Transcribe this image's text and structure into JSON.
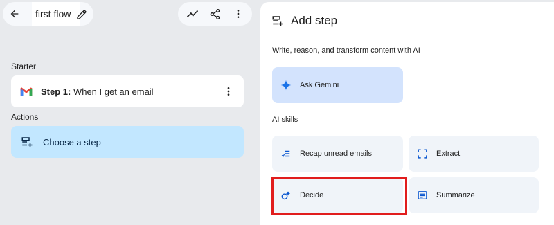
{
  "header": {
    "flow_name": "first flow"
  },
  "left": {
    "starter_label": "Starter",
    "starter_step": {
      "step_prefix": "Step 1:",
      "text": " When I get an email"
    },
    "actions_label": "Actions",
    "choose_label": "Choose a step"
  },
  "panel": {
    "title": "Add step",
    "write_section": "Write, reason, and transform content with AI",
    "ask_gemini": "Ask Gemini",
    "ai_skills_label": "AI skills",
    "skills": [
      {
        "label": "Recap unread emails",
        "icon": "recap-icon"
      },
      {
        "label": "Extract",
        "icon": "extract-icon"
      },
      {
        "label": "Decide",
        "icon": "decide-icon"
      },
      {
        "label": "Summarize",
        "icon": "summarize-icon"
      }
    ]
  },
  "colors": {
    "accent": "#0b57d0",
    "choose_bg": "#c2e7ff",
    "gemini_bg": "#d3e3fd",
    "highlight": "#e11d1d"
  }
}
